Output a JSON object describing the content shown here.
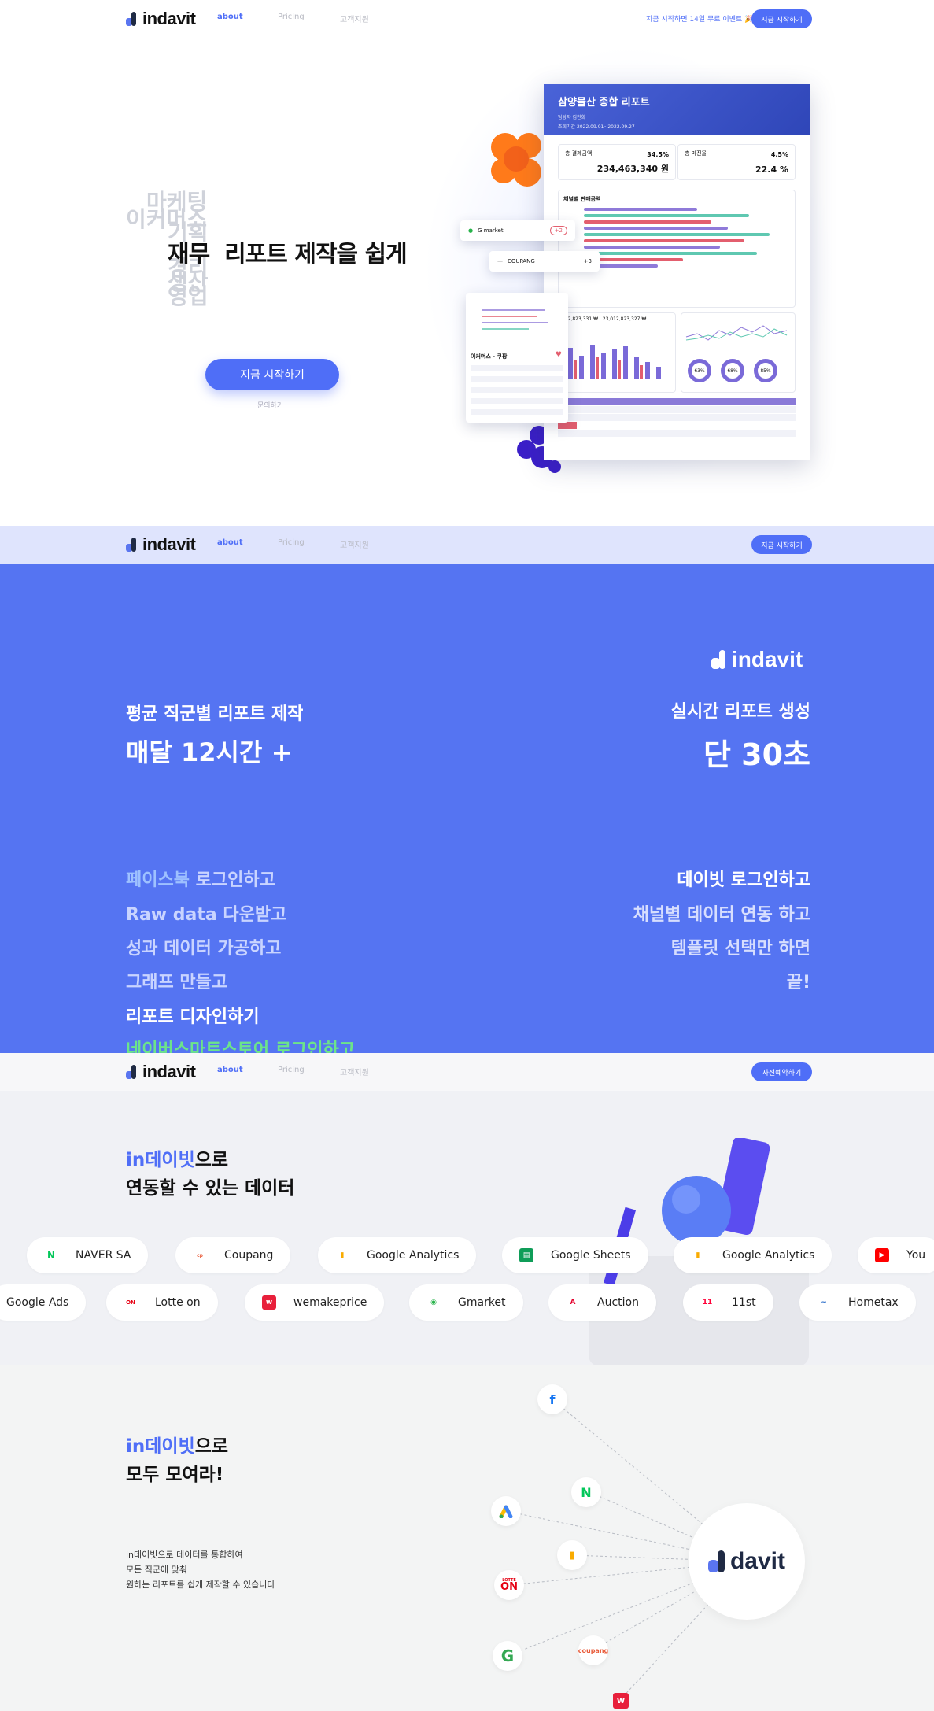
{
  "brand": {
    "name": "indavit",
    "hub_name": "davit"
  },
  "nav": {
    "links": [
      "about",
      "Pricing",
      "고객지원"
    ],
    "promo": "지금 시작하면 14일 무료 이벤트 🎉",
    "start_button": "지금 시작하기",
    "consult_button": "사전예약하기"
  },
  "hero": {
    "stack_words": [
      "마케팅",
      "이커머스",
      "기획",
      "재무",
      "경리",
      "생산",
      "영업"
    ],
    "title_suffix": "리포트 제작을 쉽게",
    "title_word": "재무",
    "cta": "지금 시작하기",
    "subcta": "문의하기"
  },
  "report": {
    "title": "삼양물산 종합 리포트",
    "meta1": "담당자   김찬희",
    "meta2": "조회기간   2022.09.01~2022.09.27",
    "kpi1_label": "총 결제금액",
    "kpi1_pct": "34.5%",
    "kpi1_value": "234,463,340 원",
    "kpi2_label": "총 마진율",
    "kpi2_pct": "4.5%",
    "kpi2_value": "22.4 %",
    "bar_title": "채널별 판매금액",
    "float1": "G market",
    "float1_badge": "+2",
    "float2": "COUPANG",
    "float2_badge": "+3",
    "card_title": "이커머스 - 쿠팡",
    "sub_value1": "612,823,331 ₩",
    "sub_value2": "23,012,823,327 ₩",
    "gauges": [
      "63%",
      "68%",
      "85%"
    ]
  },
  "blue": {
    "left_small": "평균 직군별 리포트 제작",
    "left_big": "매달 12시간 +",
    "right_small": "실시간 리포트 생성",
    "right_big": "단 30초",
    "left_list": [
      "페이스북 로그인하고",
      "Raw data 다운받고",
      "성과 데이터 가공하고",
      "그래프 만들고",
      "리포트 디자인하기",
      "네이버스마트스토어 로그인하고"
    ],
    "left_list_accent": [
      "페이스북",
      "",
      "",
      "",
      "",
      ""
    ],
    "right_list": [
      "데이빗 로그인하고",
      "채널별 데이터 연동 하고",
      "템플릿 선택만 하면",
      "끝!"
    ]
  },
  "integrations": {
    "title_accent": "in데이빗",
    "title_rest1": "으로",
    "title_line2": "연동할 수 있는 데이터",
    "row1": [
      "NAVER SA",
      "Coupang",
      "Google Analytics",
      "Google Sheets",
      "Google Analytics",
      "You"
    ],
    "row2": [
      "Google Ads",
      "Lotte on",
      "wemakeprice",
      "Gmarket",
      "Auction",
      "11st",
      "Hometax"
    ]
  },
  "gather": {
    "title_accent": "in데이빗",
    "title_rest1": "으로",
    "title_line2": "모두 모여라!",
    "desc": [
      "in데이빗으로 데이터를 통합하여",
      "모든 직군에 맞춰",
      "원하는 리포트를 쉽게 제작할 수 있습니다"
    ],
    "coupang_label": "coupang",
    "lotte_label": "LOTTE",
    "lotte_on": "ON"
  },
  "colors": {
    "accent": "#4f6ef7",
    "blue_bg": "#5574f2",
    "dark": "#1f2a44"
  }
}
